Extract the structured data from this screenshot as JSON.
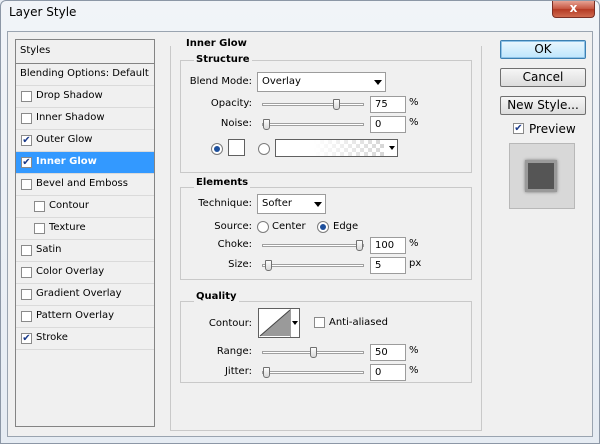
{
  "window": {
    "title": "Layer Style",
    "close_glyph": "x"
  },
  "styles_list": {
    "header": "Styles",
    "items": [
      {
        "label": "Blending Options: Default",
        "has_checkbox": false,
        "checked": false,
        "indent": false,
        "selected": false
      },
      {
        "label": "Drop Shadow",
        "has_checkbox": true,
        "checked": false,
        "indent": false,
        "selected": false
      },
      {
        "label": "Inner Shadow",
        "has_checkbox": true,
        "checked": false,
        "indent": false,
        "selected": false
      },
      {
        "label": "Outer Glow",
        "has_checkbox": true,
        "checked": true,
        "indent": false,
        "selected": false
      },
      {
        "label": "Inner Glow",
        "has_checkbox": true,
        "checked": true,
        "indent": false,
        "selected": true
      },
      {
        "label": "Bevel and Emboss",
        "has_checkbox": true,
        "checked": false,
        "indent": false,
        "selected": false
      },
      {
        "label": "Contour",
        "has_checkbox": true,
        "checked": false,
        "indent": true,
        "selected": false
      },
      {
        "label": "Texture",
        "has_checkbox": true,
        "checked": false,
        "indent": true,
        "selected": false
      },
      {
        "label": "Satin",
        "has_checkbox": true,
        "checked": false,
        "indent": false,
        "selected": false
      },
      {
        "label": "Color Overlay",
        "has_checkbox": true,
        "checked": false,
        "indent": false,
        "selected": false
      },
      {
        "label": "Gradient Overlay",
        "has_checkbox": true,
        "checked": false,
        "indent": false,
        "selected": false
      },
      {
        "label": "Pattern Overlay",
        "has_checkbox": true,
        "checked": false,
        "indent": false,
        "selected": false
      },
      {
        "label": "Stroke",
        "has_checkbox": true,
        "checked": true,
        "indent": false,
        "selected": false
      }
    ]
  },
  "inner_glow": {
    "title": "Inner Glow",
    "structure": {
      "title": "Structure",
      "blend_mode_label": "Blend Mode:",
      "blend_mode_value": "Overlay",
      "opacity_label": "Opacity:",
      "opacity_value": "75",
      "opacity_unit": "%",
      "opacity_level": 0.75,
      "noise_label": "Noise:",
      "noise_value": "0",
      "noise_unit": "%",
      "noise_level": 0.0,
      "color_mode": "solid",
      "swatch_color": "#ffffff"
    },
    "elements": {
      "title": "Elements",
      "technique_label": "Technique:",
      "technique_value": "Softer",
      "source_label": "Source:",
      "source_center": "Center",
      "source_edge": "Edge",
      "source_selected": "edge",
      "choke_label": "Choke:",
      "choke_value": "100",
      "choke_unit": "%",
      "choke_level": 1.0,
      "size_label": "Size:",
      "size_value": "5",
      "size_unit": "px",
      "size_level": 0.02
    },
    "quality": {
      "title": "Quality",
      "contour_label": "Contour:",
      "anti_aliased_label": "Anti-aliased",
      "anti_aliased_checked": false,
      "range_label": "Range:",
      "range_value": "50",
      "range_unit": "%",
      "range_level": 0.5,
      "jitter_label": "Jitter:",
      "jitter_value": "0",
      "jitter_unit": "%",
      "jitter_level": 0.0
    }
  },
  "actions": {
    "ok_label": "OK",
    "cancel_label": "Cancel",
    "new_style_label": "New Style...",
    "preview_label": "Preview",
    "preview_checked": true
  },
  "colors": {
    "selection": "#3399ff",
    "check": "#1a3a8a"
  }
}
